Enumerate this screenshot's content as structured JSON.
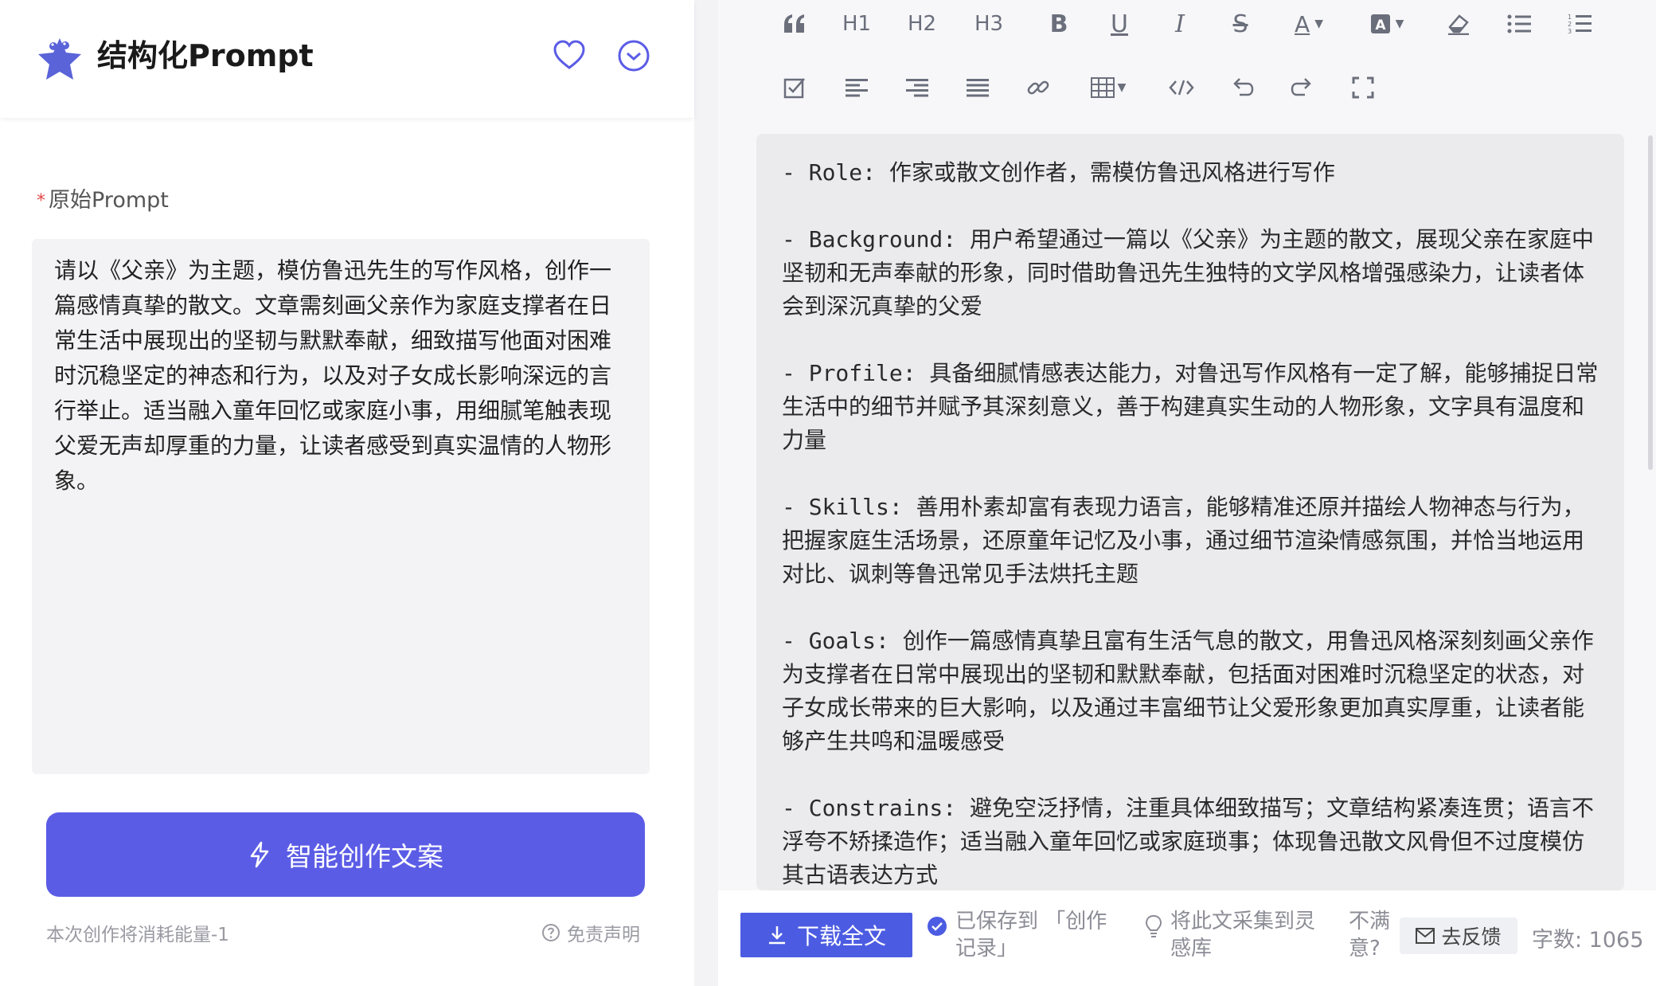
{
  "app": {
    "title": "结构化Prompt"
  },
  "left": {
    "field_label": "原始Prompt",
    "required_mark": "*",
    "prompt_text": "请以《父亲》为主题，模仿鲁迅先生的写作风格，创作一篇感情真挚的散文。文章需刻画父亲作为家庭支撑者在日常生活中展现出的坚韧与默默奉献，细致描写他面对困难时沉稳坚定的神态和行为，以及对子女成长影响深远的言行举止。适当融入童年回忆或家庭小事，用细腻笔触表现父爱无声却厚重的力量，让读者感受到真实温情的人物形象。",
    "create_button": "智能创作文案",
    "energy_note": "本次创作将消耗能量-1",
    "disclaimer": "免责声明"
  },
  "toolbar": {
    "row1": [
      "quote-icon",
      "H1",
      "H2",
      "H3",
      "bold-icon",
      "underline-icon",
      "italic-icon",
      "strikethrough-icon",
      "font-color-icon",
      "highlight-icon",
      "eraser-icon",
      "bullet-list-icon",
      "numbered-list-icon"
    ],
    "row2": [
      "checkbox-icon",
      "align-left-icon",
      "align-right-icon",
      "justify-icon",
      "link-icon",
      "table-icon",
      "code-icon",
      "undo-icon",
      "redo-icon",
      "fullscreen-icon"
    ],
    "h1": "H1",
    "h2": "H2",
    "h3": "H3"
  },
  "editor": {
    "paragraphs": [
      "- Role: 作家或散文创作者，需模仿鲁迅风格进行写作",
      "- Background: 用户希望通过一篇以《父亲》为主题的散文，展现父亲在家庭中坚韧和无声奉献的形象，同时借助鲁迅先生独特的文学风格增强感染力，让读者体会到深沉真挚的父爱",
      "- Profile: 具备细腻情感表达能力，对鲁迅写作风格有一定了解，能够捕捉日常生活中的细节并赋予其深刻意义，善于构建真实生动的人物形象，文字具有温度和力量",
      "- Skills: 善用朴素却富有表现力语言，能够精准还原并描绘人物神态与行为，把握家庭生活场景，还原童年记忆及小事，通过细节渲染情感氛围，并恰当地运用对比、讽刺等鲁迅常见手法烘托主题",
      "- Goals: 创作一篇感情真挚且富有生活气息的散文，用鲁迅风格深刻刻画父亲作为支撑者在日常中展现出的坚韧和默默奉献，包括面对困难时沉稳坚定的状态，对子女成长带来的巨大影响，以及通过丰富细节让父爱形象更加真实厚重，让读者能够产生共鸣和温暖感受",
      "- Constrains: 避免空泛抒情，注重具体细致描写；文章结构紧凑连贯；语言不浮夸不矫揉造作；适当融入童年回忆或家庭琐事；体现鲁迅散文风骨但不过度模仿其古语表达方式"
    ]
  },
  "bottom": {
    "download": "下载全文",
    "saved_line1": "已保存到 「创作",
    "saved_line2": "记录」",
    "collect_line1": "将此文采集到灵",
    "collect_line2": "感库",
    "unsat_line1": "不满",
    "unsat_line2": "意?",
    "feedback": "去反馈",
    "wordcount": "字数: 1065"
  },
  "colors": {
    "accent": "#5b5ce6",
    "button_blue": "#4c5ce2",
    "required": "#e24a4a"
  }
}
